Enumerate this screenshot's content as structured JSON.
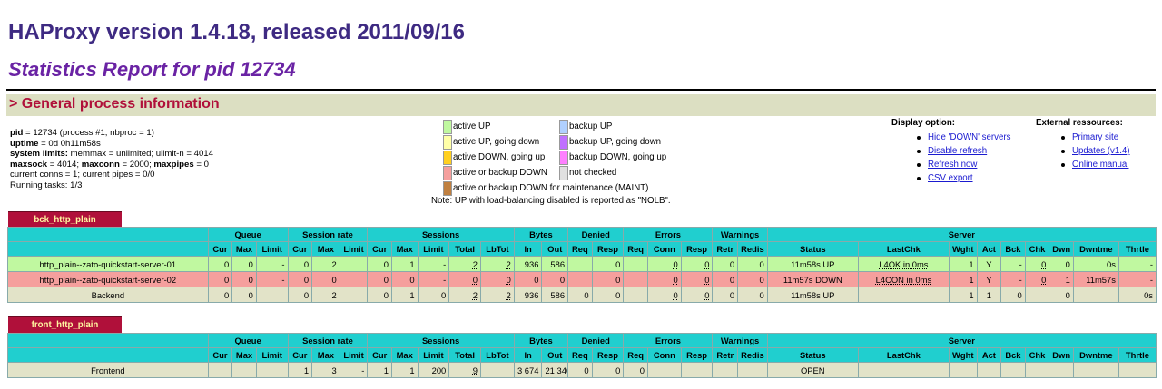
{
  "header": {
    "title": "HAProxy version 1.4.18, released 2011/09/16",
    "subtitle": "Statistics Report for pid 12734",
    "section": "> General process information"
  },
  "process": {
    "pid_label": "pid",
    "pid_value": " = 12734 (process #1, nbproc = 1)",
    "uptime_label": "uptime",
    "uptime_value": " = 0d 0h11m58s",
    "limits_label": "system limits:",
    "limits_value": " memmax = unlimited; ulimit-n = 4014",
    "maxsock_label": "maxsock",
    "maxsock_value": " = 4014; ",
    "maxconn_label": "maxconn",
    "maxconn_value": " = 2000; ",
    "maxpipes_label": "maxpipes",
    "maxpipes_value": " = 0",
    "conns": "current conns = 1; current pipes = 0/0",
    "tasks": "Running tasks: 1/3"
  },
  "legend": {
    "items": [
      {
        "label": "active UP",
        "color": "#c0f8a0"
      },
      {
        "label": "active UP, going down",
        "color": "#ffffa8"
      },
      {
        "label": "active DOWN, going up",
        "color": "#ffd020"
      },
      {
        "label": "active or backup DOWN",
        "color": "#f59f9d"
      },
      {
        "label": "active or backup DOWN for maintenance (MAINT)",
        "color": "#c08040"
      },
      {
        "label": "backup UP",
        "color": "#b0d0ff"
      },
      {
        "label": "backup UP, going down",
        "color": "#c070ff"
      },
      {
        "label": "backup DOWN, going up",
        "color": "#ff80ff"
      },
      {
        "label": "not checked",
        "color": "#e0e0e0"
      }
    ],
    "note": "Note: UP with load-balancing disabled is reported as \"NOLB\"."
  },
  "display_options": {
    "heading": "Display option:",
    "links": [
      "Hide 'DOWN' servers",
      "Disable refresh",
      "Refresh now",
      "CSV export"
    ]
  },
  "external": {
    "heading": "External ressources:",
    "links": [
      "Primary site",
      "Updates (v1.4)",
      "Online manual"
    ]
  },
  "backend": {
    "name": "bck_http_plain",
    "groups": [
      "Queue",
      "Session rate",
      "Sessions",
      "Bytes",
      "Denied",
      "Errors",
      "Warnings",
      "Server"
    ],
    "columns": [
      "Cur",
      "Max",
      "Limit",
      "Cur",
      "Max",
      "Limit",
      "Cur",
      "Max",
      "Limit",
      "Total",
      "LbTot",
      "In",
      "Out",
      "Req",
      "Resp",
      "Req",
      "Conn",
      "Resp",
      "Retr",
      "Redis",
      "Status",
      "LastChk",
      "Wght",
      "Act",
      "Bck",
      "Chk",
      "Dwn",
      "Dwntme",
      "Thrtle"
    ],
    "rows": [
      [
        "http_plain--zato-quickstart-server-01",
        "0",
        "0",
        "-",
        "0",
        "2",
        "",
        "0",
        "1",
        "-",
        "2",
        "2",
        "936",
        "586",
        "",
        "0",
        "",
        "0",
        "0",
        "0",
        "0",
        "11m58s UP",
        "L4OK in 0ms",
        "1",
        "Y",
        "-",
        "0",
        "0",
        "0s",
        "-"
      ],
      [
        "http_plain--zato-quickstart-server-02",
        "0",
        "0",
        "-",
        "0",
        "0",
        "",
        "0",
        "0",
        "-",
        "0",
        "0",
        "0",
        "0",
        "",
        "0",
        "",
        "0",
        "0",
        "0",
        "0",
        "11m57s DOWN",
        "L4CON in 0ms",
        "1",
        "Y",
        "-",
        "0",
        "1",
        "11m57s",
        "-"
      ],
      [
        "Backend",
        "0",
        "0",
        "",
        "0",
        "2",
        "",
        "0",
        "1",
        "0",
        "2",
        "2",
        "936",
        "586",
        "0",
        "0",
        "",
        "0",
        "0",
        "0",
        "0",
        "11m58s UP",
        "",
        "1",
        "1",
        "0",
        "",
        "0",
        "",
        "0s"
      ]
    ]
  },
  "frontend": {
    "name": "front_http_plain",
    "groups": [
      "Queue",
      "Session rate",
      "Sessions",
      "Bytes",
      "Denied",
      "Errors",
      "Warnings",
      "Server"
    ],
    "columns": [
      "Cur",
      "Max",
      "Limit",
      "Cur",
      "Max",
      "Limit",
      "Cur",
      "Max",
      "Limit",
      "Total",
      "LbTot",
      "In",
      "Out",
      "Req",
      "Resp",
      "Req",
      "Conn",
      "Resp",
      "Retr",
      "Redis",
      "Status",
      "LastChk",
      "Wght",
      "Act",
      "Bck",
      "Chk",
      "Dwn",
      "Dwntme",
      "Thrtle"
    ],
    "row": [
      "Frontend",
      "",
      "",
      "",
      "1",
      "3",
      "-",
      "1",
      "1",
      "200",
      "9",
      "",
      "3 674",
      "21 346",
      "0",
      "0",
      "0",
      "",
      "",
      "",
      "",
      "OPEN",
      "",
      "",
      "",
      "",
      "",
      "",
      "",
      ""
    ]
  }
}
